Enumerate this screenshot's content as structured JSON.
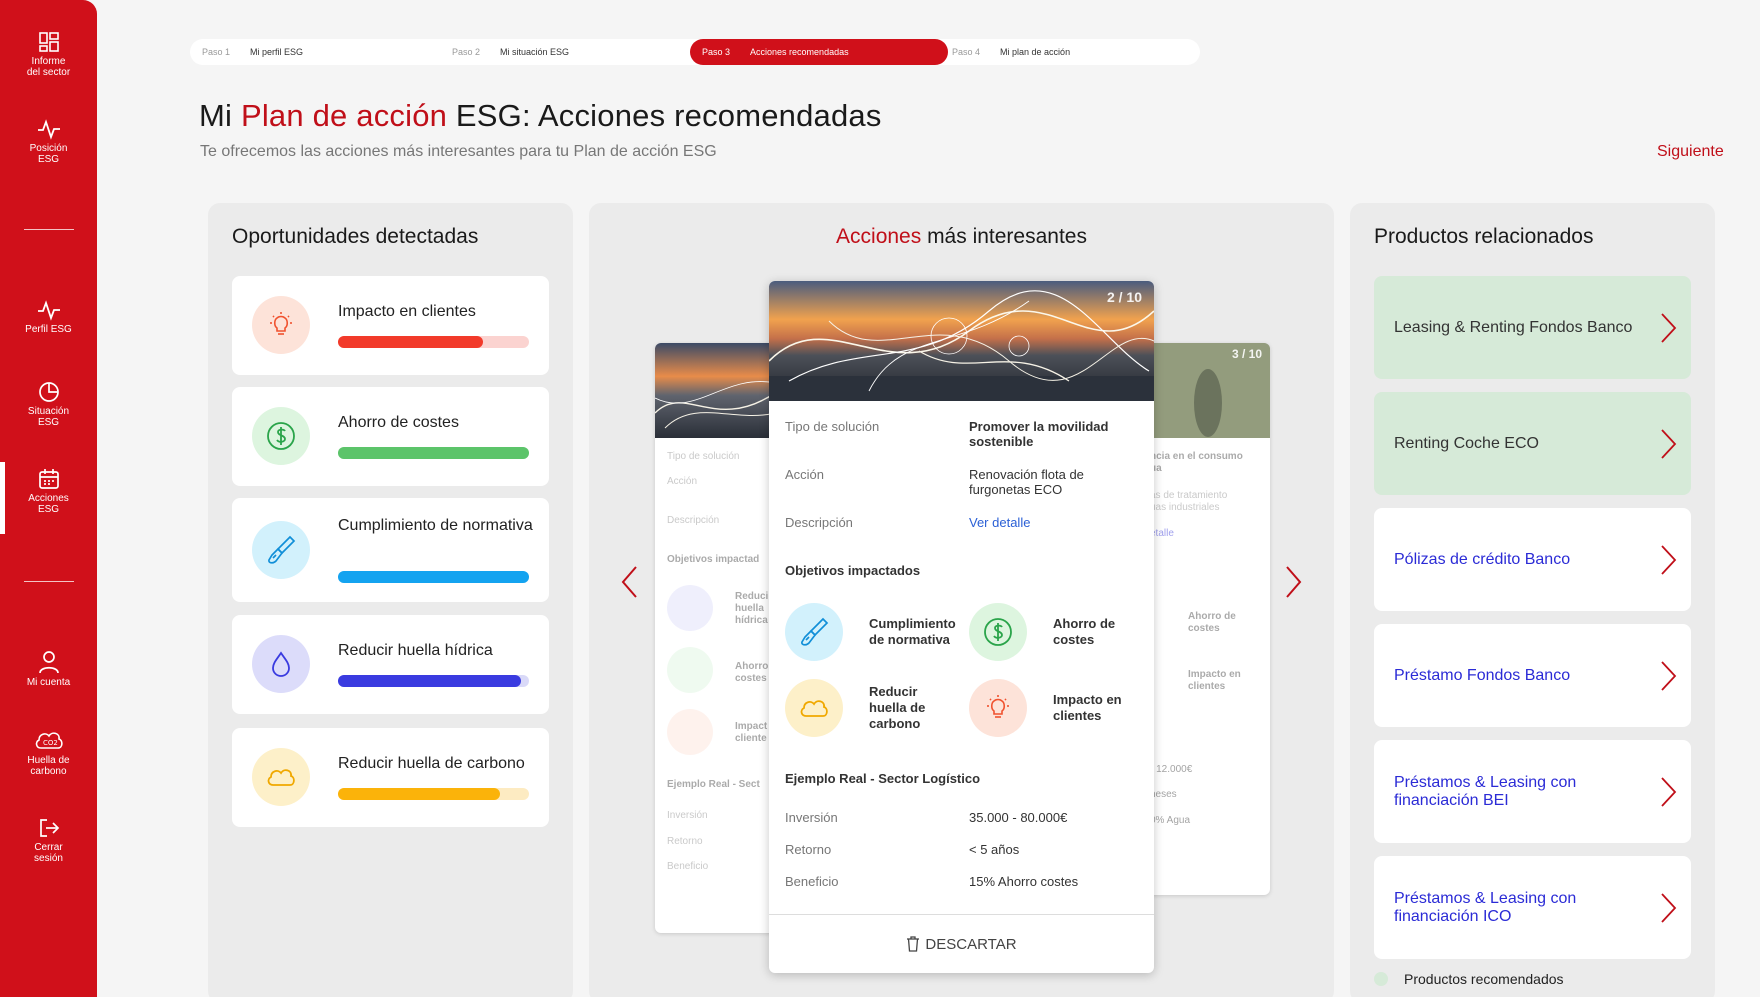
{
  "sidebar": {
    "items": [
      {
        "label_1": "Informe",
        "label_2": "del sector",
        "icon": "grid-icon"
      },
      {
        "label_1": "Posición",
        "label_2": "ESG",
        "icon": "pulse-icon"
      },
      {
        "label_1": "Perfil ESG",
        "label_2": "",
        "icon": "pulse-icon"
      },
      {
        "label_1": "Situación",
        "label_2": "ESG",
        "icon": "pie-chart-icon"
      },
      {
        "label_1": "Acciones",
        "label_2": "ESG",
        "icon": "calendar-icon"
      },
      {
        "label_1": "Mi cuenta",
        "label_2": "",
        "icon": "user-icon"
      },
      {
        "label_1": "Huella de",
        "label_2": "carbono",
        "icon": "co2-cloud-icon"
      },
      {
        "label_1": "Cerrar",
        "label_2": "sesión",
        "icon": "logout-icon"
      }
    ]
  },
  "stepper": {
    "steps": [
      {
        "num": "Paso 1",
        "label": "Mi perfil ESG"
      },
      {
        "num": "Paso 2",
        "label": "Mi situación ESG"
      },
      {
        "num": "Paso 3",
        "label": "Acciones recomendadas"
      },
      {
        "num": "Paso 4",
        "label": "Mi plan de acción"
      }
    ]
  },
  "header": {
    "title_pre": "Mi ",
    "title_accent": "Plan de acción",
    "title_post": " ESG: Acciones recomendadas",
    "subtitle": "Te ofrecemos las acciones más interesantes para tu Plan de acción ESG",
    "next": "Siguiente"
  },
  "opportunities": {
    "title": "Oportunidades detectadas",
    "items": [
      {
        "label": "Impacto en clientes",
        "level": 0.76,
        "color": "#f23a2a",
        "track": "#fbd3d0",
        "icon_bg": "#fde3d9",
        "icon": "lightbulb-icon"
      },
      {
        "label": "Ahorro de costes",
        "level": 1.0,
        "color": "#5cc46a",
        "track": "#d3f0d6",
        "icon_bg": "#ddf5df",
        "icon": "dollar-icon"
      },
      {
        "label": "Cumplimiento de normativa",
        "level": 1.0,
        "color": "#14a3f0",
        "track": "#cdeefc",
        "icon_bg": "#d2f1fc",
        "icon": "brush-icon"
      },
      {
        "label": "Reducir huella hídrica",
        "level": 0.96,
        "color": "#3a3be0",
        "track": "#d9d9f8",
        "icon_bg": "#dcdcfa",
        "icon": "drop-icon"
      },
      {
        "label": "Reducir huella de carbono",
        "level": 0.85,
        "color": "#fbb30a",
        "track": "#fdebc2",
        "icon_bg": "#fdf0c9",
        "icon": "cloud-icon"
      }
    ]
  },
  "actions": {
    "title_accent": "Acciones",
    "title_rest": " más interesantes",
    "main": {
      "counter": "2 / 10",
      "tipo_label": "Tipo de solución",
      "tipo_value": "Promover la movilidad sostenible",
      "accion_label": "Acción",
      "accion_value": "Renovación flota de furgonetas ECO",
      "desc_label": "Descripción",
      "desc_link": "Ver detalle",
      "objetivos_title": "Objetivos impactados",
      "objetivos": [
        {
          "label": "Cumplimiento de normativa",
          "icon": "brush-icon"
        },
        {
          "label": "Ahorro de costes",
          "icon": "dollar-icon"
        },
        {
          "label": "Reducir huella de carbono",
          "icon": "cloud-icon"
        },
        {
          "label": "Impacto en clientes",
          "icon": "lightbulb-icon"
        }
      ],
      "ejemplo_title": "Ejemplo Real - Sector Logístico",
      "inversion_label": "Inversión",
      "inversion_value": "35.000 - 80.000€",
      "retorno_label": "Retorno",
      "retorno_value": "< 5 años",
      "beneficio_label": "Beneficio",
      "beneficio_value": "15% Ahorro costes",
      "discard": "DESCARTAR"
    },
    "left_card": {
      "tipo": "Tipo de solución",
      "accion": "Acción",
      "desc": "Descripción",
      "objetivos": "Objetivos impactad",
      "obj1": "Reduci",
      "obj1b": "huella",
      "obj1c": "hídrica",
      "obj2": "Ahorro",
      "obj2b": "costes",
      "obj3": "Impact",
      "obj3b": "cliente",
      "ejemplo": "Ejemplo Real - Sect",
      "inversion": "Inversión",
      "retorno": "Retorno",
      "beneficio": "Beneficio"
    },
    "right_card": {
      "counter": "3 / 10",
      "l1": "ncia en el consumo",
      "l1b": "ua",
      "l2": "as de tratamiento",
      "l2b": "uas industriales",
      "link": "etalle",
      "o1": "Ahorro de",
      "o1b": "costes",
      "o2": "Impacto en",
      "o2b": "clientes",
      "v1": "- 12.000€",
      "v2": "neses",
      "v3": "0% Agua"
    }
  },
  "products": {
    "title": "Productos relacionados",
    "items": [
      {
        "label": "Leasing & Renting Fondos Banco",
        "recommended": true
      },
      {
        "label": "Renting Coche ECO",
        "recommended": true
      },
      {
        "label": "Pólizas de crédito Banco",
        "recommended": false
      },
      {
        "label": "Préstamo Fondos Banco",
        "recommended": false
      },
      {
        "label": "Préstamos & Leasing con financiación BEI",
        "recommended": false
      },
      {
        "label": "Préstamos & Leasing con financiación ICO",
        "recommended": false
      }
    ],
    "legend": "Productos recomendados"
  },
  "colors": {
    "brand": "#d0101a",
    "accent_text": "#c00f19",
    "link": "#2b2bd6",
    "recommended_bg": "#d6ead8"
  }
}
